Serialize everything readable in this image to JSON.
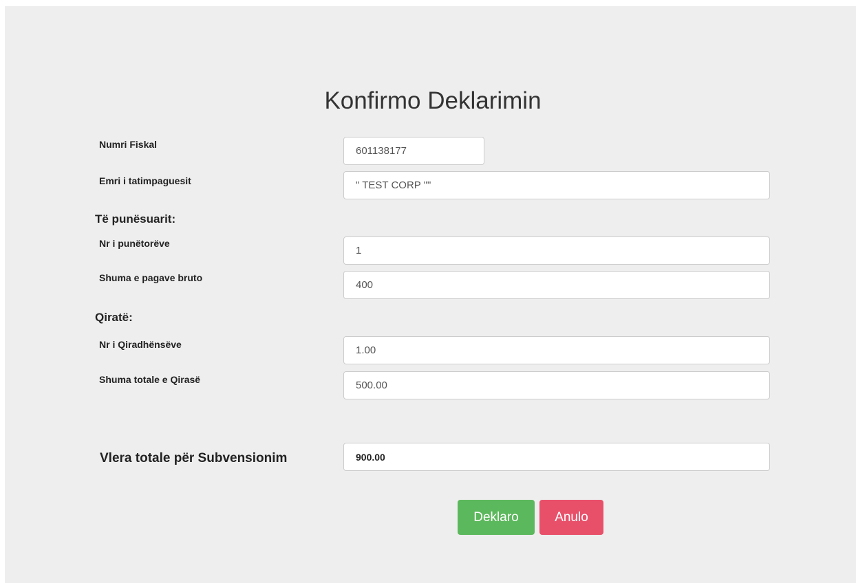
{
  "page": {
    "title": "Konfirmo Deklarimin"
  },
  "taxpayer": {
    "fiscal_number_label": "Numri Fiskal",
    "fiscal_number_value": "601138177",
    "name_label": "Emri i tatimpaguesit",
    "name_value": "\" TEST CORP \"\""
  },
  "employees": {
    "section_title": "Të punësuarit:",
    "count_label": "Nr i punëtorëve",
    "count_value": "1",
    "gross_label": "Shuma e pagave bruto",
    "gross_value": "400"
  },
  "rent": {
    "section_title": "Qiratë:",
    "landlords_label": "Nr i Qiradhënsëve",
    "landlords_value": "1.00",
    "total_label": "Shuma totale e Qirasë",
    "total_value": "500.00"
  },
  "subsidy": {
    "label": "Vlera totale për Subvensionim",
    "value": "900.00"
  },
  "actions": {
    "declare_label": "Deklaro",
    "cancel_label": "Anulo"
  },
  "colors": {
    "background": "#eeeeee",
    "declare_button": "#5cb85c",
    "cancel_button": "#e8506a"
  }
}
